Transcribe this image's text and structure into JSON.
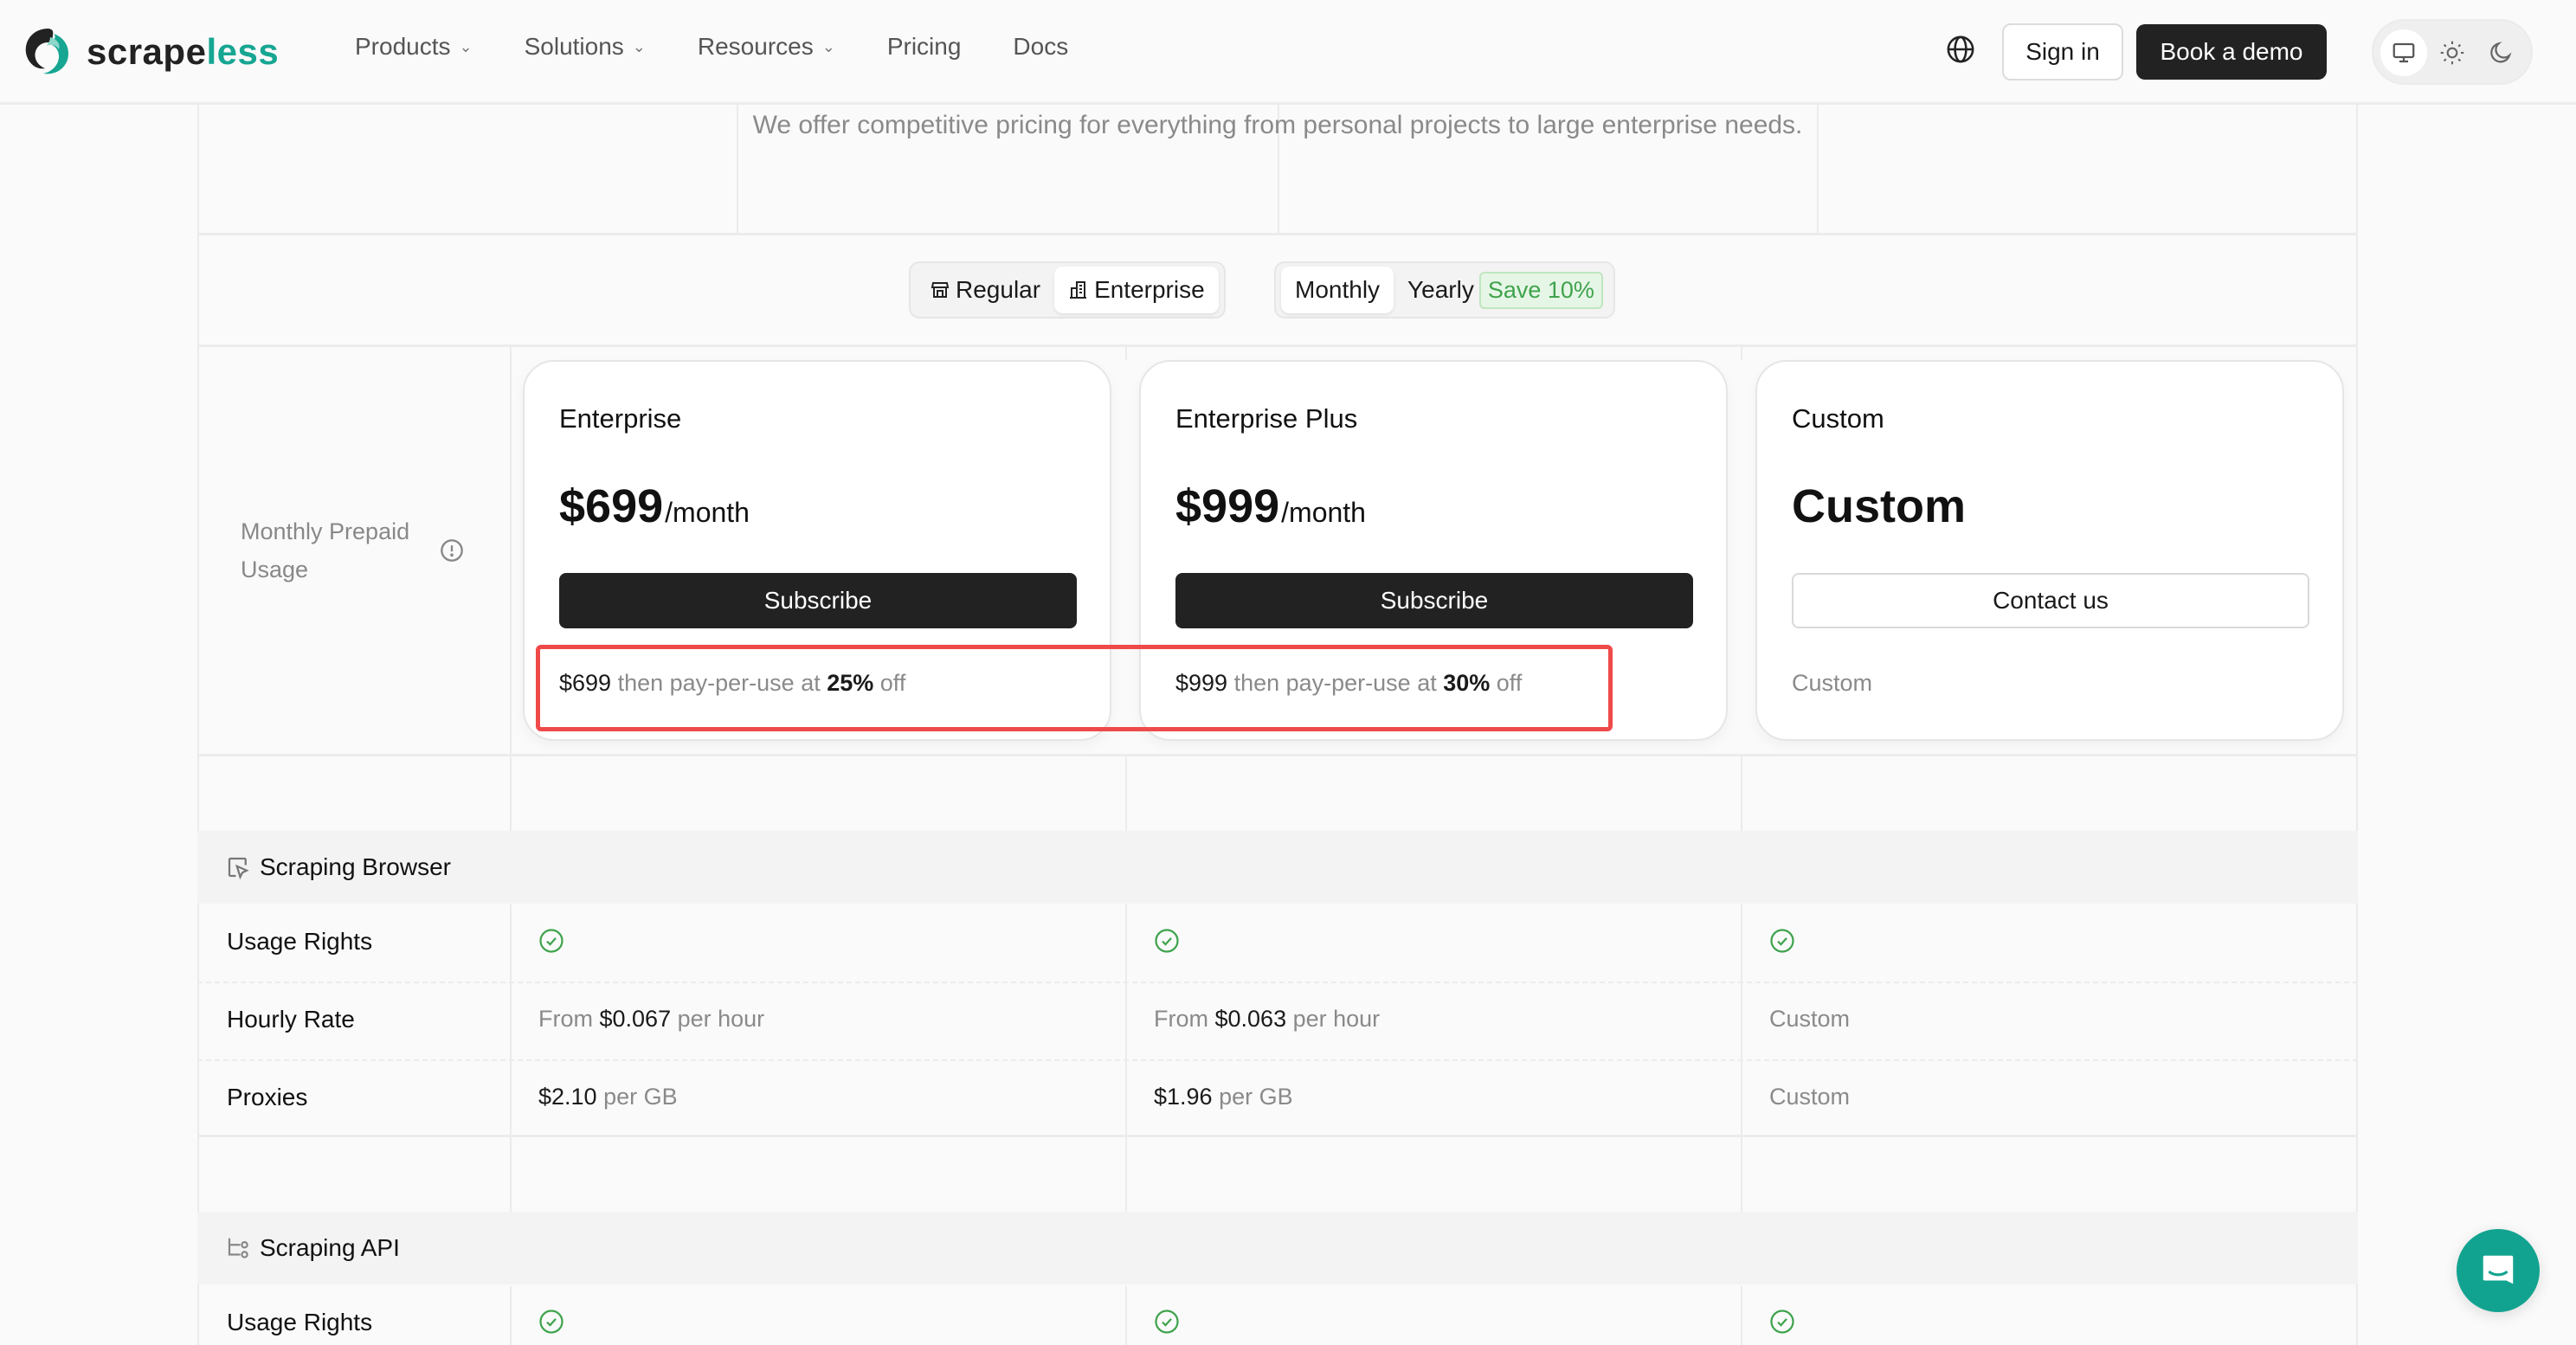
{
  "header": {
    "logo": {
      "text_dark": "scrape",
      "text_accent": "less"
    },
    "nav": [
      {
        "label": "Products",
        "has_dropdown": true
      },
      {
        "label": "Solutions",
        "has_dropdown": true
      },
      {
        "label": "Resources",
        "has_dropdown": true
      },
      {
        "label": "Pricing",
        "has_dropdown": false
      },
      {
        "label": "Docs",
        "has_dropdown": false
      }
    ],
    "language_icon": "globe-icon",
    "sign_in": "Sign in",
    "book_demo": "Book a demo",
    "theme_options": [
      {
        "icon": "monitor-icon",
        "active": true
      },
      {
        "icon": "sun-icon",
        "active": false
      },
      {
        "icon": "moon-icon",
        "active": false
      }
    ]
  },
  "subtitle": "We offer competitive pricing for everything from personal projects to large enterprise needs.",
  "plan_type_toggle": {
    "options": [
      {
        "label": "Regular",
        "icon": "store-icon",
        "active": false
      },
      {
        "label": "Enterprise",
        "icon": "building-icon",
        "active": true
      }
    ]
  },
  "billing_toggle": {
    "options": [
      {
        "label": "Monthly",
        "active": true
      },
      {
        "label": "Yearly",
        "active": false
      }
    ],
    "save_badge": "Save 10%"
  },
  "row_label": {
    "text": "Monthly Prepaid Usage",
    "icon": "info-icon"
  },
  "plans": [
    {
      "name": "Enterprise",
      "price": "$699",
      "period": "/month",
      "button": "Subscribe",
      "note": {
        "amount": "$699",
        "middle": " then pay-per-use at ",
        "discount": "25%",
        "suffix": " off"
      }
    },
    {
      "name": "Enterprise Plus",
      "price": "$999",
      "period": "/month",
      "button": "Subscribe",
      "note": {
        "amount": "$999",
        "middle": " then pay-per-use at ",
        "discount": "30%",
        "suffix": " off"
      }
    },
    {
      "name": "Custom",
      "price": "Custom",
      "period": "",
      "button": "Contact us",
      "note": {
        "plain": "Custom"
      }
    }
  ],
  "sections": [
    {
      "title": "Scraping Browser",
      "icon": "browser-cursor-icon",
      "rows": [
        {
          "label": "Usage Rights",
          "cells": [
            {
              "check": true
            },
            {
              "check": true
            },
            {
              "check": true
            }
          ]
        },
        {
          "label": "Hourly Rate",
          "cells": [
            {
              "prefix": "From ",
              "value": "$0.067",
              "suffix": " per hour"
            },
            {
              "prefix": "From ",
              "value": "$0.063",
              "suffix": " per hour"
            },
            {
              "plain": "Custom"
            }
          ]
        },
        {
          "label": "Proxies",
          "cells": [
            {
              "prefix": "",
              "value": "$2.10",
              "suffix": " per GB"
            },
            {
              "prefix": "",
              "value": "$1.96",
              "suffix": " per GB"
            },
            {
              "plain": "Custom"
            }
          ]
        }
      ]
    },
    {
      "title": "Scraping API",
      "icon": "api-tree-icon",
      "rows": [
        {
          "label": "Usage Rights",
          "cells": [
            {
              "check": true
            },
            {
              "check": true
            },
            {
              "check": true
            }
          ]
        }
      ]
    }
  ],
  "colors": {
    "brand_teal": "#16a692",
    "check_green": "#3fa34d",
    "highlight_red": "#ef4a4a",
    "dark_button": "#222222"
  },
  "chat_widget": {
    "icon": "chat-icon"
  }
}
